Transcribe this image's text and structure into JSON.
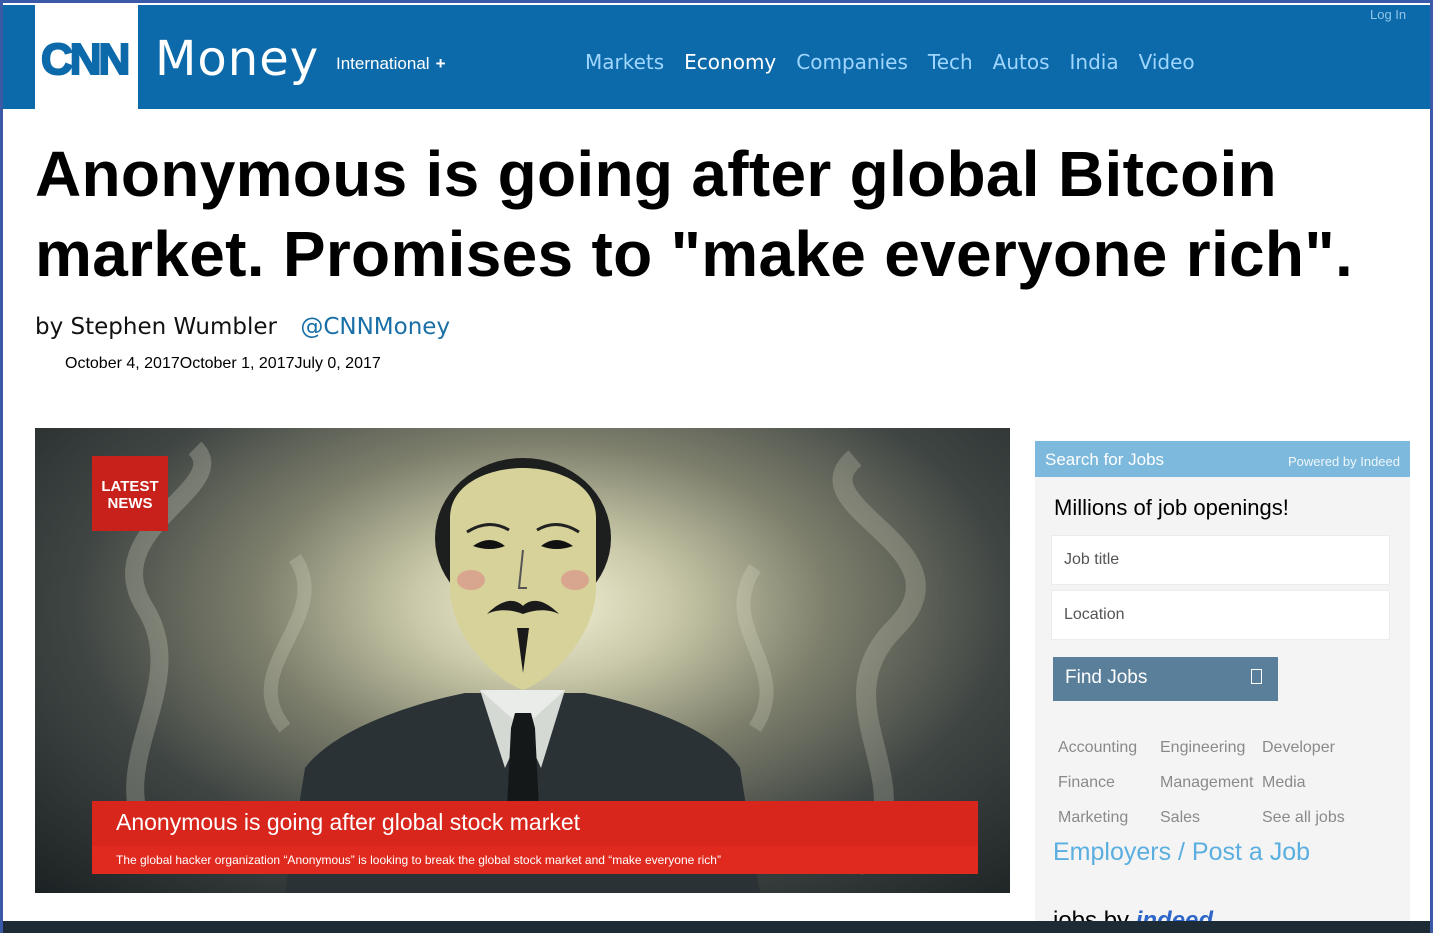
{
  "header": {
    "logo": "CNN",
    "brand": "Money",
    "edition": "International",
    "edition_plus": "+",
    "login": "Log In",
    "nav": [
      "Markets",
      "Economy",
      "Companies",
      "Tech",
      "Autos",
      "India",
      "Video"
    ],
    "active_nav": "Economy"
  },
  "article": {
    "headline": "Anonymous is going after global Bitcoin market. Promises to \"make everyone rich\".",
    "byline": "by Stephen Wumbler",
    "handle": "@CNNMoney",
    "dates": "October 4, 2017October 1, 2017July 0, 2017"
  },
  "hero": {
    "badge_line1": "LATEST",
    "badge_line2": "NEWS",
    "lower_title": "Anonymous is going after global stock market",
    "lower_sub": "The global hacker organization “Anonymous” is looking to break the global stock market and “make everyone rich”"
  },
  "jobs": {
    "title": "Search for Jobs",
    "powered": "Powered by Indeed",
    "tagline": "Millions of job openings!",
    "job_placeholder": "Job title",
    "location_placeholder": "Location",
    "find_label": "Find Jobs",
    "categories": [
      "Accounting",
      "Engineering",
      "Developer",
      "Finance",
      "Management",
      "Media",
      "Marketing",
      "Sales",
      "See all jobs"
    ],
    "employers": "Employers / Post a Job",
    "jobs_by": "jobs by",
    "indeed": "indeed"
  },
  "colors": {
    "brand_blue": "#0c6aab",
    "nav_link": "#9fd6ff",
    "news_red": "#d8261c",
    "jobs_header": "#7cb9dd"
  }
}
